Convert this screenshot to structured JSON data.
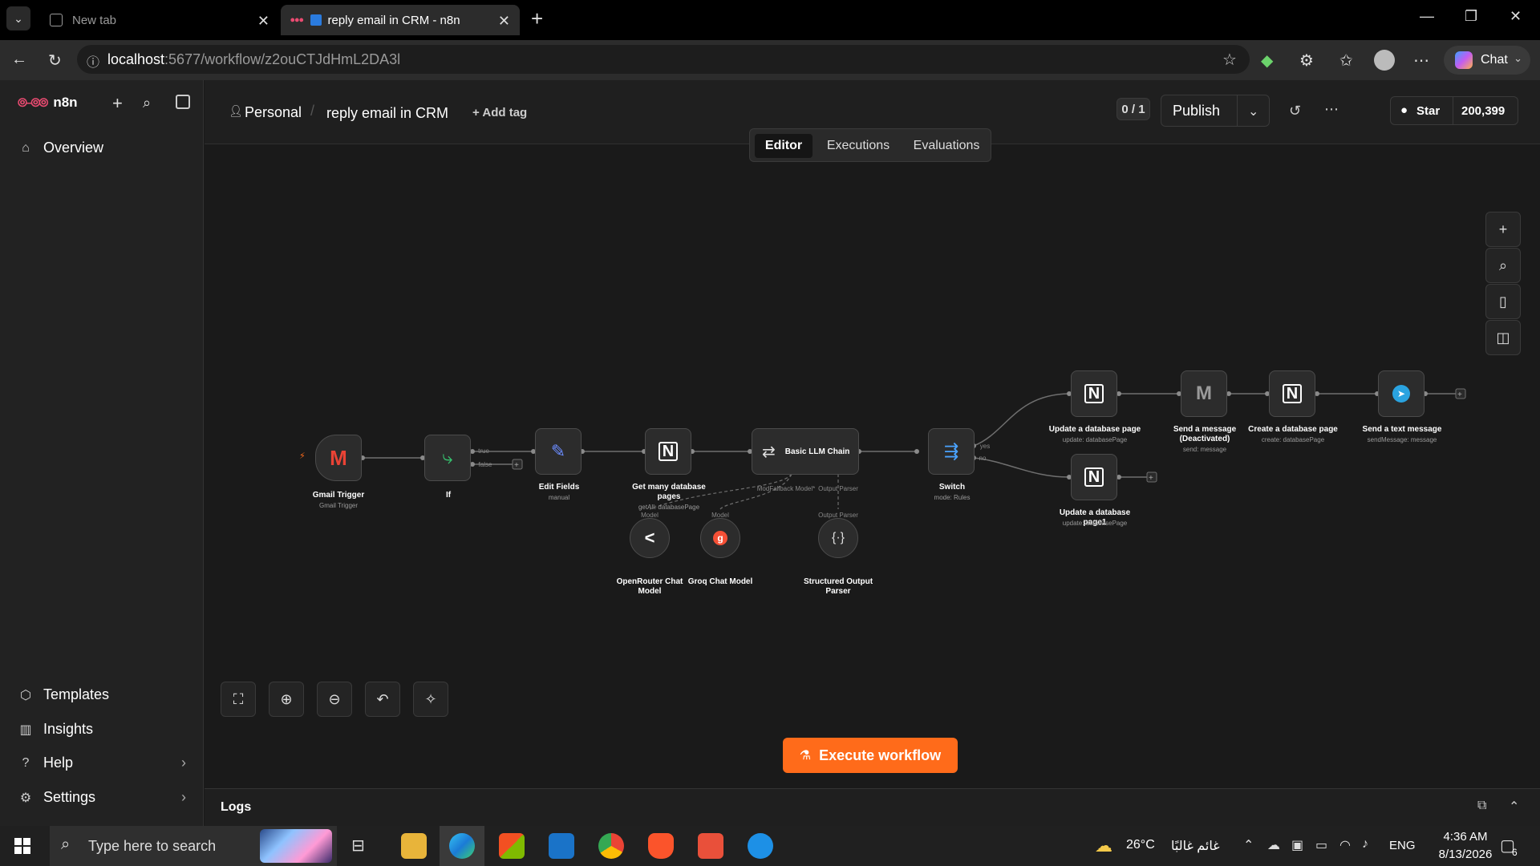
{
  "browser": {
    "tabs": [
      {
        "label": "New tab"
      },
      {
        "label": "reply email in CRM - n8n"
      }
    ],
    "url_host": "localhost",
    "url_path": ":5677/workflow/z2ouCTJdHmL2DA3l",
    "chat_label": "Chat"
  },
  "sidebar": {
    "brand": "n8n",
    "overview": "Overview",
    "bottom_items": [
      {
        "label": "Templates"
      },
      {
        "label": "Insights"
      },
      {
        "label": "Help"
      },
      {
        "label": "Settings"
      }
    ]
  },
  "header": {
    "project": "Personal",
    "workflow_name": "reply email in CRM",
    "add_tag": "+ Add tag",
    "counter": "0 / 1",
    "publish": "Publish",
    "star_label": "Star",
    "star_count": "200,399",
    "tabs": [
      {
        "label": "Editor"
      },
      {
        "label": "Executions"
      },
      {
        "label": "Evaluations"
      }
    ]
  },
  "nodes": {
    "gmail_trigger": {
      "label": "Gmail Trigger",
      "sub": "Gmail Trigger"
    },
    "if": {
      "label": "If",
      "true": "true",
      "false": "false"
    },
    "edit_fields": {
      "label": "Edit Fields",
      "sub": "manual"
    },
    "get_pages": {
      "label": "Get many database pages",
      "sub": "getAll: databasePage"
    },
    "llm_chain": {
      "label": "Basic LLM Chain",
      "port_model": "ModFallback Model*",
      "port_parser": "Output Parser"
    },
    "switch": {
      "label": "Switch",
      "sub": "mode: Rules",
      "yes": "yes",
      "no": "no"
    },
    "openrouter": {
      "label": "OpenRouter Chat Model",
      "port": "Model"
    },
    "groq": {
      "label": "Groq Chat Model",
      "port": "Model"
    },
    "parser": {
      "label": "Structured Output Parser",
      "port": "Output Parser"
    },
    "update_page": {
      "label": "Update a database page",
      "sub": "update: databasePage"
    },
    "send_message": {
      "label": "Send a message (Deactivated)",
      "sub": "send: message"
    },
    "create_page": {
      "label": "Create a database page",
      "sub": "create: databasePage"
    },
    "send_text": {
      "label": "Send a text message",
      "sub": "sendMessage: message"
    },
    "update_page1": {
      "label": "Update a database page1",
      "sub": "update: databasePage"
    }
  },
  "canvas": {
    "execute": "Execute workflow",
    "logs": "Logs"
  },
  "taskbar": {
    "search_placeholder": "Type here to search",
    "weather": "26°C",
    "weather_text": "غائم غالبًا",
    "language": "ENG",
    "time": "4:36 AM",
    "date": "8/13/2026",
    "notifications": "6"
  },
  "colors": {
    "accent": "#ff6b1a",
    "canvas_bg": "#1a1a1a",
    "node_bg": "#2c2c2c"
  }
}
